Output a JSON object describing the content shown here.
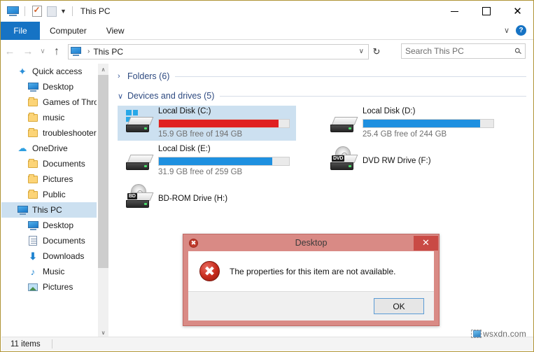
{
  "window": {
    "title": "This PC",
    "quick_access_icons": [
      "this-pc-icon",
      "properties-icon",
      "new-folder-icon",
      "customize-chevron-icon"
    ],
    "controls": {
      "minimize": "–",
      "maximize": "□",
      "close": "✕"
    }
  },
  "ribbon": {
    "tabs": [
      {
        "label": "File",
        "active": true
      },
      {
        "label": "Computer",
        "active": false
      },
      {
        "label": "View",
        "active": false
      }
    ],
    "collapse_chevron": "∨",
    "help_label": "?"
  },
  "addressbar": {
    "back": "←",
    "forward": "→",
    "history": "∨",
    "up": "↑",
    "icon": "this-pc-icon",
    "separator": "›",
    "path": "This PC",
    "dropdown": "∨",
    "refresh": "↻"
  },
  "search": {
    "placeholder": "Search This PC",
    "icon": "search-icon"
  },
  "sidebar": {
    "items": [
      {
        "label": "Quick access",
        "icon": "star-icon",
        "indent": 0,
        "selected": false
      },
      {
        "label": "Desktop",
        "icon": "monitor-icon",
        "indent": 1,
        "selected": false
      },
      {
        "label": "Games of Thron",
        "icon": "folder-icon",
        "indent": 1,
        "selected": false
      },
      {
        "label": "music",
        "icon": "folder-icon",
        "indent": 1,
        "selected": false
      },
      {
        "label": "troubleshooter",
        "icon": "folder-icon",
        "indent": 1,
        "selected": false
      },
      {
        "label": "OneDrive",
        "icon": "cloud-icon",
        "indent": 0,
        "selected": false
      },
      {
        "label": "Documents",
        "icon": "folder-icon",
        "indent": 1,
        "selected": false
      },
      {
        "label": "Pictures",
        "icon": "folder-icon",
        "indent": 1,
        "selected": false
      },
      {
        "label": "Public",
        "icon": "folder-icon",
        "indent": 1,
        "selected": false
      },
      {
        "label": "This PC",
        "icon": "monitor-icon",
        "indent": 0,
        "selected": true
      },
      {
        "label": "Desktop",
        "icon": "monitor-icon",
        "indent": 1,
        "selected": false
      },
      {
        "label": "Documents",
        "icon": "documents-icon",
        "indent": 1,
        "selected": false
      },
      {
        "label": "Downloads",
        "icon": "download-arrow-icon",
        "indent": 1,
        "selected": false
      },
      {
        "label": "Music",
        "icon": "music-note-icon",
        "indent": 1,
        "selected": false
      },
      {
        "label": "Pictures",
        "icon": "pictures-icon",
        "indent": 1,
        "selected": false
      }
    ],
    "scroll_up": "∧",
    "scroll_down": "∨"
  },
  "content": {
    "groups": [
      {
        "label": "Folders (6)",
        "chevron": "›",
        "expanded": false
      },
      {
        "label": "Devices and drives (5)",
        "chevron": "∨",
        "expanded": true
      }
    ],
    "drives": [
      {
        "name": "Local Disk (C:)",
        "sub": "15.9 GB free of 194 GB",
        "icon": "windows-drive-icon",
        "has_bar": true,
        "bar_percent": 92,
        "bar_color": "#e02020",
        "selected": true,
        "col": 0,
        "row": 0
      },
      {
        "name": "Local Disk (D:)",
        "sub": "25.4 GB free of 244 GB",
        "icon": "hard-drive-icon",
        "has_bar": true,
        "bar_percent": 90,
        "bar_color": "#1e90e0",
        "selected": false,
        "col": 1,
        "row": 0
      },
      {
        "name": "Local Disk (E:)",
        "sub": "31.9 GB free of 259 GB",
        "icon": "hard-drive-icon",
        "has_bar": true,
        "bar_percent": 87,
        "bar_color": "#1e90e0",
        "selected": false,
        "col": 0,
        "row": 1
      },
      {
        "name": "DVD RW Drive (F:)",
        "sub": "",
        "icon": "dvd-drive-icon",
        "disc_label": "DVD",
        "has_bar": false,
        "selected": false,
        "col": 1,
        "row": 1
      },
      {
        "name": "BD-ROM Drive (H:)",
        "sub": "",
        "icon": "bdrom-drive-icon",
        "disc_label": "BD",
        "has_bar": false,
        "selected": false,
        "col": 0,
        "row": 2
      }
    ]
  },
  "statusbar": {
    "item_count": "11 items"
  },
  "watermark": {
    "text": "wsxdn.com"
  },
  "dialog": {
    "title": "Desktop",
    "system_icon": "✖",
    "close_label": "✕",
    "error_icon": "✖",
    "message": "The properties for this item are not available.",
    "ok_label": "OK",
    "accent_color": "#d98a85",
    "close_button_color": "#c94a45"
  }
}
